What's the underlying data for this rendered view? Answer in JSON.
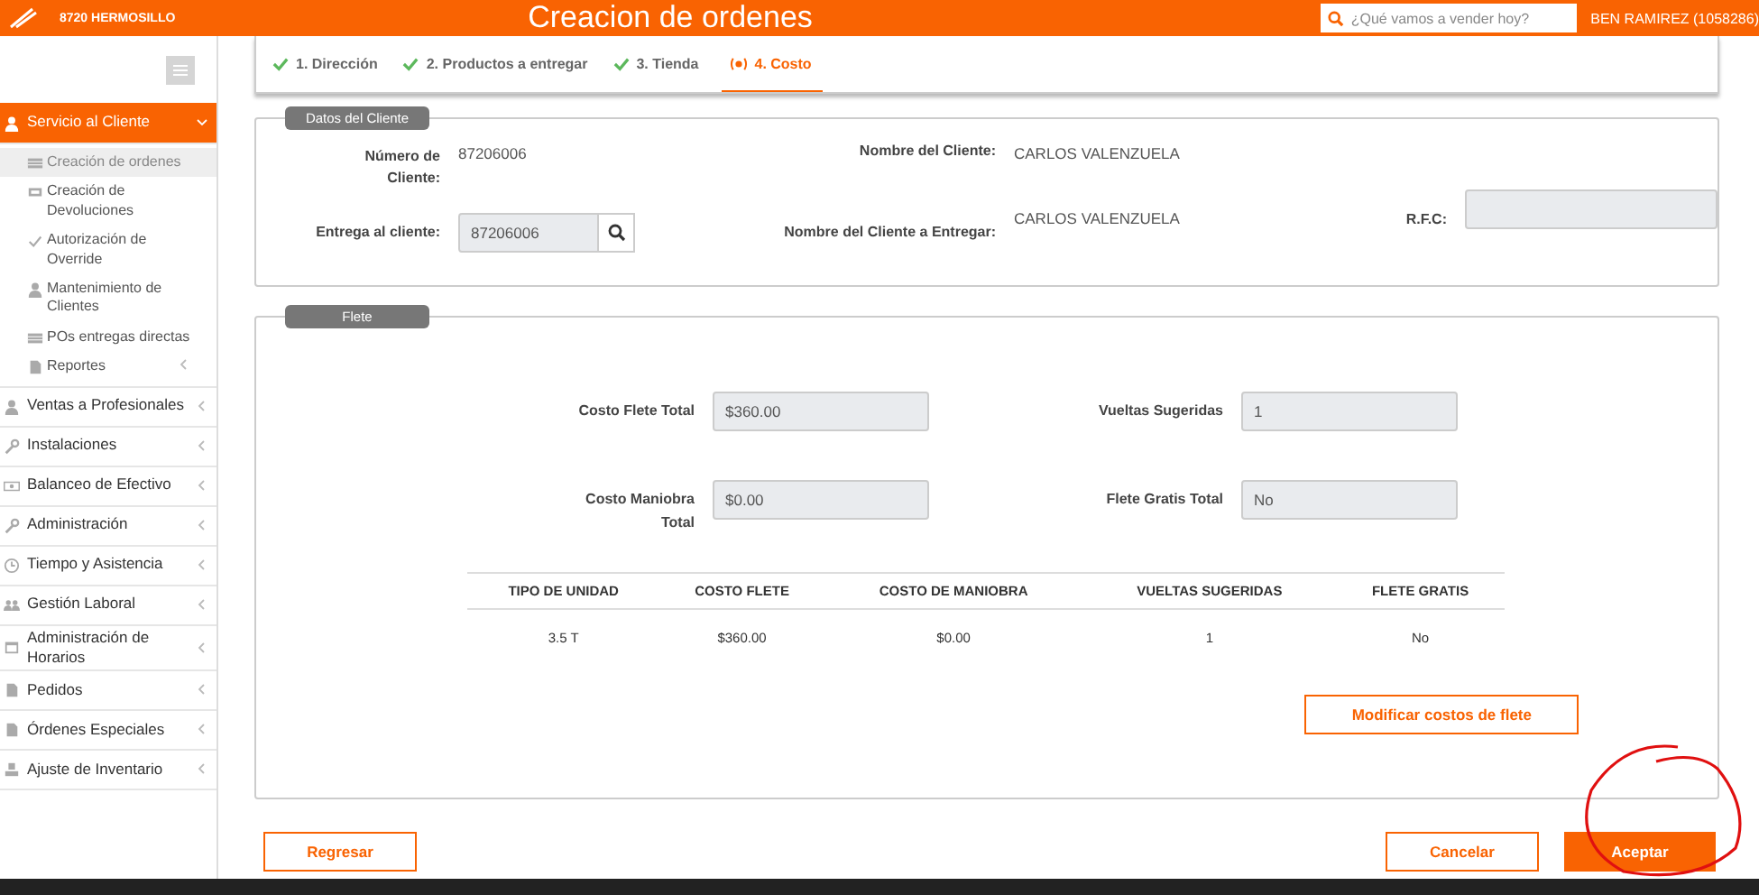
{
  "header": {
    "store": "8720 HERMOSILLO",
    "title": "Creacion de ordenes",
    "search": {
      "placeholder": "¿Qué vamos a vender hoy?"
    },
    "user": "BEN RAMIREZ (1058286)"
  },
  "sidebar": {
    "items": [
      {
        "label": "Servicio al Cliente",
        "selected": true,
        "expanded": true,
        "children": [
          {
            "label": "Creación de ordenes",
            "selected": true
          },
          {
            "label": "Creación de Devoluciones",
            "selected": false
          },
          {
            "label": "Autorización de Override",
            "selected": false
          },
          {
            "label": "Mantenimiento de Clientes",
            "selected": false
          },
          {
            "label": "POs entregas directas",
            "selected": false
          },
          {
            "label": "Reportes",
            "selected": false,
            "expandable": true
          }
        ]
      },
      {
        "label": "Ventas a Profesionales",
        "selected": false,
        "expanded": false
      },
      {
        "label": "Instalaciones",
        "selected": false,
        "expanded": false
      },
      {
        "label": "Balanceo de Efectivo",
        "selected": false,
        "expanded": false
      },
      {
        "label": "Administración",
        "selected": false,
        "expanded": false
      },
      {
        "label": "Tiempo y Asistencia",
        "selected": false,
        "expanded": false
      },
      {
        "label": "Gestión Laboral",
        "selected": false,
        "expanded": false
      },
      {
        "label": "Administración de Horarios",
        "selected": false,
        "expanded": false
      },
      {
        "label": "Pedidos",
        "selected": false,
        "expanded": false
      },
      {
        "label": "Órdenes Especiales",
        "selected": false,
        "expanded": false
      },
      {
        "label": "Ajuste de Inventario",
        "selected": false,
        "expanded": false
      }
    ]
  },
  "steps": [
    {
      "label": "1. Dirección",
      "selected": false
    },
    {
      "label": "2. Productos a entregar",
      "selected": false
    },
    {
      "label": "3. Tienda",
      "selected": false
    },
    {
      "label": "4. Costo",
      "selected": true
    }
  ],
  "client_section": {
    "title": "Datos del Cliente",
    "client_number_label": "Número de Cliente:",
    "client_number": "87206006",
    "delivery_label": "Entrega al cliente:",
    "delivery_value": "87206006",
    "client_name_label": "Nombre del Cliente:",
    "client_name": "CARLOS VALENZUELA",
    "deliver_name_label": "Nombre del Cliente a Entregar:",
    "deliver_name": "CARLOS VALENZUELA",
    "rfc_label": "R.F.C:"
  },
  "freight_section": {
    "title": "Flete",
    "fields": [
      {
        "label": "Costo Flete Total",
        "value": "$360.00"
      },
      {
        "label": "Vueltas Sugeridas",
        "value": "1"
      },
      {
        "label": "Costo Maniobra Total",
        "value": "$0.00"
      },
      {
        "label": "Flete Gratis Total",
        "value": "No"
      }
    ],
    "table": {
      "columns": [
        "TIPO DE UNIDAD",
        "COSTO FLETE",
        "COSTO DE MANIOBRA",
        "VUELTAS SUGERIDAS",
        "FLETE GRATIS"
      ],
      "rows": [
        [
          "3.5 T",
          "$360.00",
          "$0.00",
          "1",
          "No"
        ]
      ]
    },
    "modify_button": "Modificar costos de flete"
  },
  "buttons": {
    "back": "Regresar",
    "cancel": "Cancelar",
    "accept": "Aceptar"
  }
}
